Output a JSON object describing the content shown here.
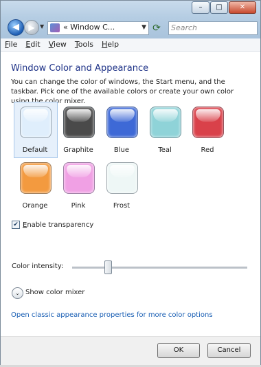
{
  "toolbar": {
    "address_text": "« Window C...",
    "search_placeholder": "Search"
  },
  "menu": [
    {
      "pre": "",
      "u": "F",
      "post": "ile"
    },
    {
      "pre": "",
      "u": "E",
      "post": "dit"
    },
    {
      "pre": "",
      "u": "V",
      "post": "iew"
    },
    {
      "pre": "",
      "u": "T",
      "post": "ools"
    },
    {
      "pre": "",
      "u": "H",
      "post": "elp"
    }
  ],
  "main": {
    "title": "Window Color and Appearance",
    "description": "You can change the color of windows, the Start menu, and the taskbar. Pick one of the available colors or create your own color using the color mixer.",
    "swatches": [
      {
        "label": "Default",
        "color": "#dfeefc",
        "selected": true
      },
      {
        "label": "Graphite",
        "color": "#4a4a4a"
      },
      {
        "label": "Blue",
        "color": "#3e69d6"
      },
      {
        "label": "Teal",
        "color": "#8fd3d8"
      },
      {
        "label": "Red",
        "color": "#d9414a"
      },
      {
        "label": "Orange",
        "color": "#f39a3f"
      },
      {
        "label": "Pink",
        "color": "#f0a0e4"
      },
      {
        "label": "Frost",
        "color": "#eef7f6"
      }
    ],
    "transparency": {
      "pre": "",
      "u": "E",
      "post": "nable transparency",
      "checked": true
    },
    "intensity_label": "Color intensity:",
    "intensity_value": 0.2,
    "mixer_label": "Show color mixer",
    "classic_link": "Open classic appearance properties for more color options"
  },
  "footer": {
    "ok_label": "OK",
    "cancel_label": "Cancel"
  }
}
